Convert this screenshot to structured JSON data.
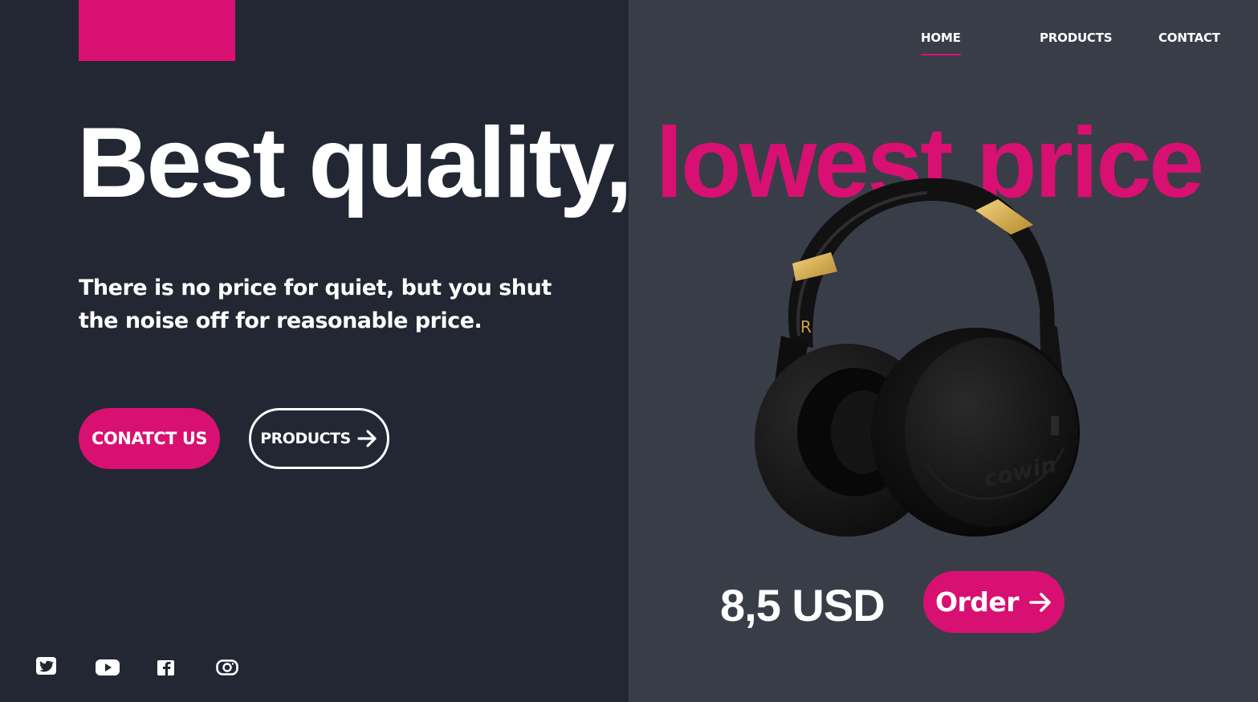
{
  "nav": {
    "home": "HOME",
    "products": "PRODUCTS",
    "contact": "CONTACT"
  },
  "hero": {
    "headline_white": "Best quality, ",
    "headline_pink": "lowest price",
    "subtitle": "There is no price for quiet, but you shut the noise off for reasonable price.",
    "contact_button": "CONATCT US",
    "products_button": "PRODUCTS"
  },
  "product": {
    "price": "8,5 USD",
    "order_button": "Order",
    "brand_text": "cowin",
    "side_mark": "R"
  },
  "social": {
    "icons": [
      "twitter-icon",
      "youtube-icon",
      "facebook-icon",
      "instagram-icon"
    ]
  },
  "colors": {
    "accent": "#d81071",
    "left_bg": "#222733",
    "right_bg": "#393d48"
  }
}
